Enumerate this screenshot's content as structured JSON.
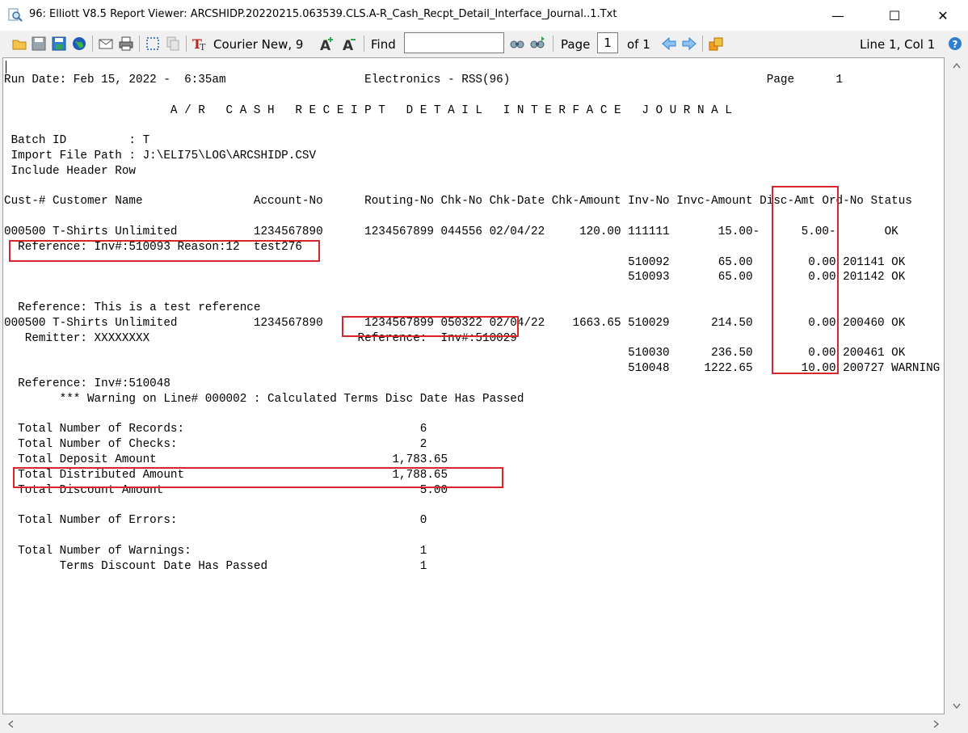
{
  "window": {
    "title": "96: Elliott V8.5 Report Viewer: ARCSHIDP.20220215.063539.CLS.A-R_Cash_Recpt_Detail_Interface_Journal..1.Txt",
    "minimize": "—",
    "maximize": "☐",
    "close": "✕",
    "app_icon": "magnifier-report-icon"
  },
  "toolbar": {
    "font_label": "Courier New, 9",
    "find_label": "Find",
    "find_value": "",
    "page_label": "Page",
    "page_value": "1",
    "of_label": "of 1",
    "cursor_status": "Line 1, Col 1",
    "icons": [
      "open-folder-icon",
      "save-icon",
      "save-as-icon",
      "globe-icon",
      "email-icon",
      "print-icon",
      "select-icon",
      "copy-icon",
      "font-icon",
      "increase-font-icon",
      "decrease-font-icon",
      "find-icon",
      "find-next-icon",
      "prev-page-icon",
      "next-page-icon",
      "export-icon",
      "help-icon"
    ]
  },
  "report": {
    "lines": [
      "Run Date: Feb 15, 2022 -  6:35am                    Electronics - RSS(96)                                     Page      1",
      "",
      "                        A / R   C A S H   R E C E I P T   D E T A I L   I N T E R F A C E   J O U R N A L",
      "",
      " Batch ID         : T",
      " Import File Path : J:\\ELI75\\LOG\\ARCSHIDP.CSV",
      " Include Header Row",
      "",
      "Cust-# Customer Name                Account-No      Routing-No Chk-No Chk-Date Chk-Amount Inv-No Invc-Amount Disc-Amt Ord-No Status",
      "",
      "000500 T-Shirts Unlimited           1234567890      1234567899 044556 02/04/22     120.00 111111       15.00-      5.00-       OK",
      "  Reference: Inv#:510093 Reason:12  test276",
      "                                                                                          510092       65.00        0.00 201141 OK",
      "                                                                                          510093       65.00        0.00 201142 OK",
      "",
      "  Reference: This is a test reference",
      "000500 T-Shirts Unlimited           1234567890      1234567899 050322 02/04/22    1663.65 510029      214.50        0.00 200460 OK",
      "   Remitter: XXXXXXXX                              Reference:  Inv#:510029",
      "                                                                                          510030      236.50        0.00 200461 OK",
      "                                                                                          510048     1222.65       10.00 200727 WARNING",
      "  Reference: Inv#:510048",
      "        *** Warning on Line# 000002 : Calculated Terms Disc Date Has Passed",
      "",
      "  Total Number of Records:                                  6",
      "  Total Number of Checks:                                   2",
      "  Total Deposit Amount                                  1,783.65",
      "  Total Distributed Amount                              1,788.65",
      "  Total Discount Amount                                     5.00",
      "",
      "  Total Number of Errors:                                   0",
      "",
      "  Total Number of Warnings:                                 1",
      "        Terms Discount Date Has Passed                      1"
    ]
  },
  "colors": {
    "highlight_box": "#d9252b",
    "paper": "#ffffff",
    "chrome": "#f0f0f0"
  }
}
